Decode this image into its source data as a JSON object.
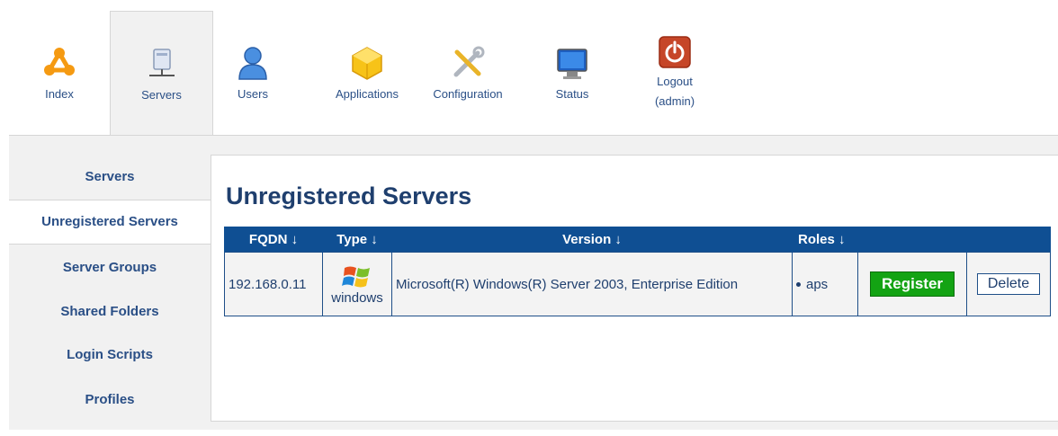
{
  "nav": {
    "index": "Index",
    "servers": "Servers",
    "users": "Users",
    "applications": "Applications",
    "configuration": "Configuration",
    "status": "Status",
    "logout": "Logout",
    "logout_user": "(admin)"
  },
  "sidebar": {
    "items": [
      {
        "label": "Servers"
      },
      {
        "label": "Unregistered Servers"
      },
      {
        "label": "Server Groups"
      },
      {
        "label": "Shared Folders"
      },
      {
        "label": "Login Scripts"
      },
      {
        "label": "Profiles"
      }
    ]
  },
  "main": {
    "title": "Unregistered Servers",
    "columns": {
      "fqdn": "FQDN ↓",
      "type": "Type ↓",
      "version": "Version ↓",
      "roles": "Roles ↓"
    },
    "rows": [
      {
        "fqdn": "192.168.0.11",
        "type": "windows",
        "version": "Microsoft(R) Windows(R) Server 2003, Enterprise Edition",
        "roles": "aps",
        "register": "Register",
        "delete": "Delete"
      }
    ]
  },
  "colors": {
    "header_bg": "#0f4f93",
    "register_bg": "#13a313",
    "text": "#1f3f6e"
  }
}
